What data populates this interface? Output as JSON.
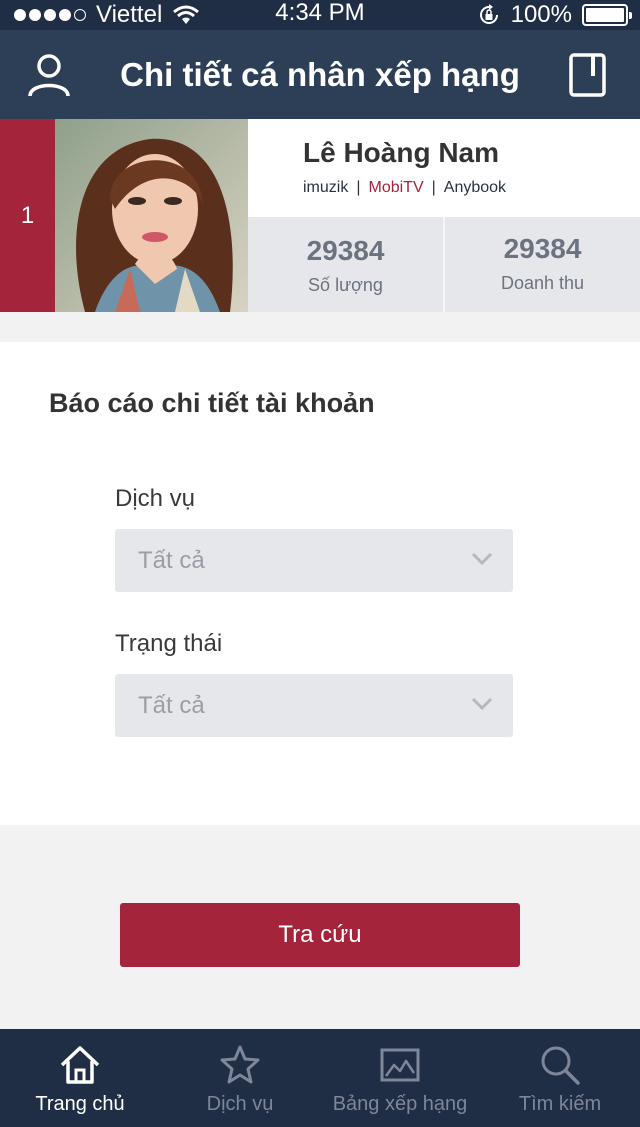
{
  "status_bar": {
    "carrier": "Viettel",
    "time": "4:34 PM",
    "battery": "100%"
  },
  "header": {
    "title": "Chi tiết cá nhân xếp hạng",
    "left_icon": "user-icon",
    "right_icon": "book-icon"
  },
  "profile": {
    "rank": "1",
    "name": "Lê Hoàng Nam",
    "services": [
      "imuzik",
      "MobiTV",
      "Anybook"
    ],
    "separator": "|",
    "stats": [
      {
        "value": "29384",
        "label": "Số lượng"
      },
      {
        "value": "29384",
        "label": "Doanh thu"
      }
    ]
  },
  "report": {
    "title": "Báo cáo chi tiết tài khoản",
    "service_label": "Dịch vụ",
    "service_value": "Tất cả",
    "status_label": "Trạng thái",
    "status_value": "Tất cả"
  },
  "search_button": "Tra cứu",
  "bottom_nav": [
    {
      "label": "Trang chủ",
      "icon": "home-icon",
      "active": true
    },
    {
      "label": "Dịch vụ",
      "icon": "star-icon",
      "active": false
    },
    {
      "label": "Bảng xếp hạng",
      "icon": "image-chart-icon",
      "active": false
    },
    {
      "label": "Tìm kiếm",
      "icon": "search-icon",
      "active": false
    }
  ],
  "colors": {
    "navy": "#1f2d45",
    "header": "#2d3e57",
    "accent": "#a4243b",
    "panel": "#e6e7eb"
  }
}
